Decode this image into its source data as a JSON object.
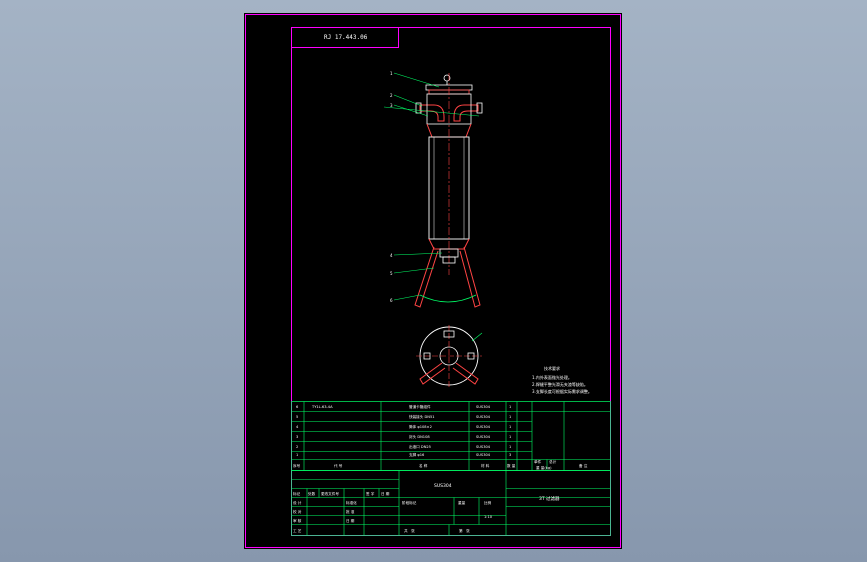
{
  "drawing_number": "RJ 17.443.06",
  "notes": {
    "heading": "技术要求",
    "lines": [
      "1.内外表面抛光处理。",
      "2.焊缝平整光滑无夹渣等缺陷。",
      "3.支脚长度可根据实际需求调整。"
    ]
  },
  "parts_table": {
    "headers": {
      "seq": "序号",
      "code": "代 号",
      "name": "名 称",
      "qty": "数 量",
      "material": "材 料",
      "mass_single": "单件",
      "mass_total": "总计",
      "mass_label": "重 量(kg)",
      "remark": "备 注"
    },
    "rows": [
      {
        "seq": "6",
        "code": "TY1L-63-4A",
        "name": "管道卡箍组件",
        "material": "SUS304",
        "qty": "1"
      },
      {
        "seq": "5",
        "code": "",
        "name": "快装接头 DN51",
        "material": "SUS304",
        "qty": "1"
      },
      {
        "seq": "4",
        "code": "",
        "name": "筒体 φ108×2",
        "material": "SUS304",
        "qty": "1"
      },
      {
        "seq": "3",
        "code": "",
        "name": "封头 DN108",
        "material": "SUS304",
        "qty": "1"
      },
      {
        "seq": "2",
        "code": "",
        "name": "出液口 DN25",
        "material": "SUS304",
        "qty": "1"
      },
      {
        "seq": "1",
        "code": "",
        "name": "支脚 φ16",
        "material": "SUS304",
        "qty": "3"
      }
    ]
  },
  "title_block": {
    "material": "SUS304",
    "drawing_title": "3T 过滤器",
    "labels": {
      "mark": "标记",
      "count": "处数",
      "division": "更改文件号",
      "signature": "签 字",
      "date": "日 期",
      "design": "设 计",
      "check": "校 对",
      "review": "审 核",
      "process": "工 艺",
      "standardize": "标准化",
      "approve": "批 准",
      "date2": "日 期",
      "stage": "阶段标记",
      "weight": "重量",
      "scale": "比例",
      "sheets": "共　张",
      "sheet": "第　张"
    },
    "scale_value": "1:10"
  }
}
